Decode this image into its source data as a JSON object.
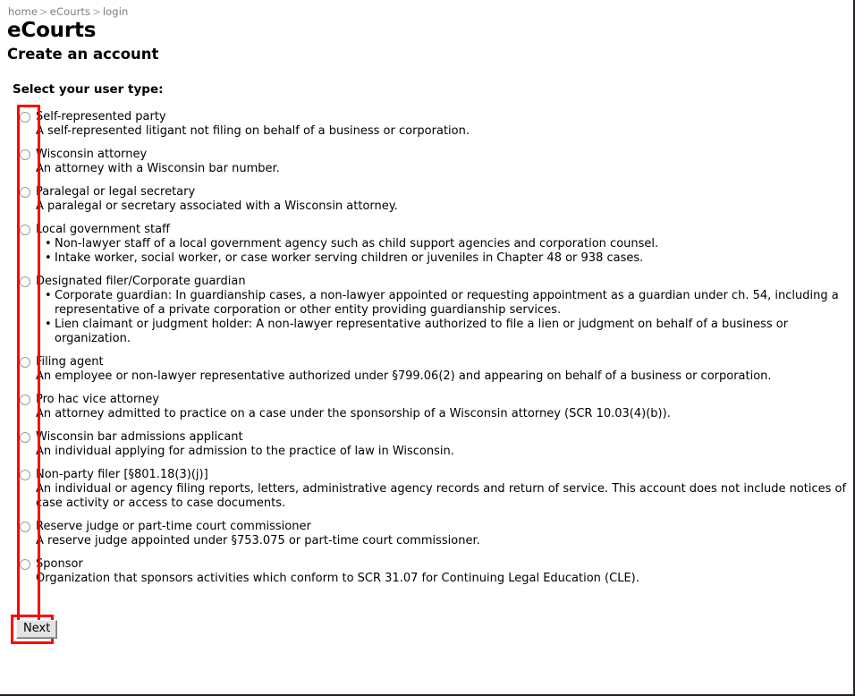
{
  "breadcrumb": {
    "items": [
      "home",
      "eCourts",
      "login"
    ],
    "separator": ">"
  },
  "header": {
    "app_title": "eCourts",
    "page_title": "Create an account"
  },
  "form": {
    "prompt": "Select your user type:",
    "selected_value": null,
    "radio_group_name": "user-type",
    "highlight_color": "#ff0000",
    "options": [
      {
        "id": "self-represented-party",
        "title": "Self-represented party",
        "desc": "A self-represented litigant not filing on behalf of a business or corporation.",
        "bullets": []
      },
      {
        "id": "wisconsin-attorney",
        "title": "Wisconsin attorney",
        "desc": "An attorney with a Wisconsin bar number.",
        "bullets": []
      },
      {
        "id": "paralegal-or-legal-secretary",
        "title": "Paralegal or legal secretary",
        "desc": "A paralegal or secretary associated with a Wisconsin attorney.",
        "bullets": []
      },
      {
        "id": "local-government-staff",
        "title": "Local government staff",
        "desc": "",
        "bullets": [
          "Non-lawyer staff of a local government agency such as child support agencies and corporation counsel.",
          "Intake worker, social worker, or case worker serving children or juveniles in Chapter 48 or 938 cases."
        ]
      },
      {
        "id": "designated-filer-corporate-guardian",
        "title": "Designated filer/Corporate guardian",
        "desc": "",
        "bullets": [
          "Corporate guardian: In guardianship cases, a non-lawyer appointed or requesting appointment as a guardian under ch. 54, including a representative of a private corporation or other entity providing guardianship services.",
          "Lien claimant or judgment holder: A non-lawyer representative authorized to file a lien or judgment on behalf of a business or organization."
        ]
      },
      {
        "id": "filing-agent",
        "title": "Filing agent",
        "desc": "An employee or non-lawyer representative authorized under §799.06(2) and appearing on behalf of a business or corporation.",
        "bullets": []
      },
      {
        "id": "pro-hac-vice-attorney",
        "title": "Pro hac vice attorney",
        "desc": "An attorney admitted to practice on a case under the sponsorship of a Wisconsin attorney (SCR 10.03(4)(b)).",
        "bullets": []
      },
      {
        "id": "wisconsin-bar-admissions-applicant",
        "title": "Wisconsin bar admissions applicant",
        "desc": "An individual applying for admission to the practice of law in Wisconsin.",
        "bullets": []
      },
      {
        "id": "non-party-filer",
        "title": "Non-party filer [§801.18(3)(j)]",
        "desc": "An individual or agency filing reports, letters, administrative agency records and return of service. This account does not include notices of case activity or access to case documents.",
        "bullets": []
      },
      {
        "id": "reserve-judge-or-part-time-court-commissioner",
        "title": "Reserve judge or part-time court commissioner",
        "desc": "A reserve judge appointed under §753.075 or part-time court commissioner.",
        "bullets": []
      },
      {
        "id": "sponsor",
        "title": "Sponsor",
        "desc": "Organization that sponsors activities which conform to SCR 31.07 for Continuing Legal Education (CLE).",
        "bullets": []
      }
    ]
  },
  "footer": {
    "next_label": "Next"
  }
}
